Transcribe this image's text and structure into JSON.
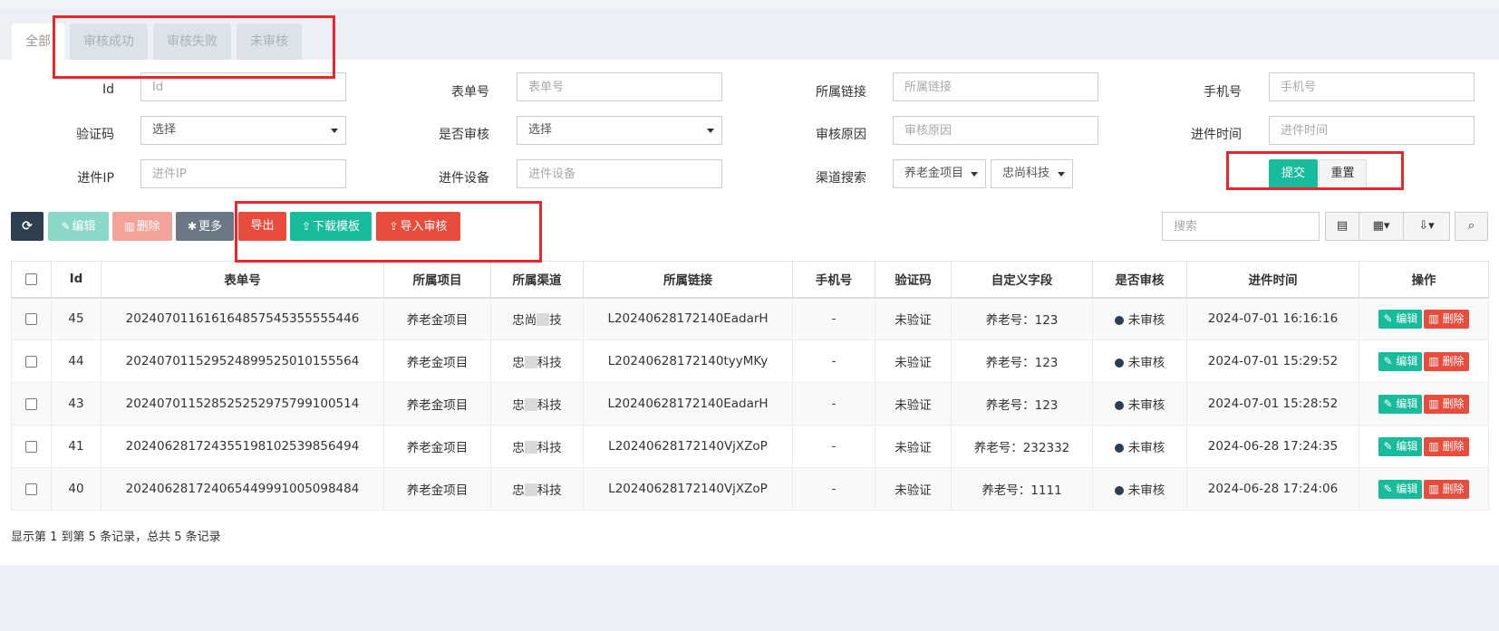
{
  "tabs": [
    "全部",
    "审核成功",
    "审核失败",
    "未审核"
  ],
  "filters": {
    "id_label": "Id",
    "id_placeholder": "Id",
    "form_no_label": "表单号",
    "form_no_placeholder": "表单号",
    "link_label": "所属链接",
    "link_placeholder": "所属链接",
    "phone_label": "手机号",
    "phone_placeholder": "手机号",
    "captcha_label": "验证码",
    "captcha_value": "选择",
    "audited_label": "是否审核",
    "audited_value": "选择",
    "reason_label": "审核原因",
    "reason_placeholder": "审核原因",
    "time_label": "进件时间",
    "time_placeholder": "进件时间",
    "ip_label": "进件IP",
    "ip_placeholder": "进件IP",
    "device_label": "进件设备",
    "device_placeholder": "进件设备",
    "channel_label": "渠道搜索",
    "channel_project": "养老金项目",
    "channel_company": "忠尚科技",
    "submit": "提交",
    "reset": "重置"
  },
  "toolbar": {
    "edit": "编辑",
    "delete": "删除",
    "more": "更多",
    "export": "导出",
    "download_template": "下载模板",
    "import_audit": "导入审核",
    "search_placeholder": "搜索"
  },
  "table": {
    "headers": [
      "Id",
      "表单号",
      "所属项目",
      "所属渠道",
      "所属链接",
      "手机号",
      "验证码",
      "自定义字段",
      "是否审核",
      "进件时间",
      "操作"
    ],
    "rows": [
      {
        "id": "45",
        "form_no": "202407011616164857545355555446",
        "project": "养老金项目",
        "channel_a": "忠尚",
        "channel_b": "技",
        "link": "L20240628172140EadarH",
        "phone": "-",
        "captcha": "未验证",
        "custom": "养老号：123",
        "audited": "未审核",
        "time": "2024-07-01 16:16:16"
      },
      {
        "id": "44",
        "form_no": "202407011529524899525010155564",
        "project": "养老金项目",
        "channel_a": "忠",
        "channel_b": "科技",
        "link": "L20240628172140tyyMKy",
        "phone": "-",
        "captcha": "未验证",
        "custom": "养老号：123",
        "audited": "未审核",
        "time": "2024-07-01 15:29:52"
      },
      {
        "id": "43",
        "form_no": "202407011528525252975799100514",
        "project": "养老金项目",
        "channel_a": "忠",
        "channel_b": "科技",
        "link": "L20240628172140EadarH",
        "phone": "-",
        "captcha": "未验证",
        "custom": "养老号：123",
        "audited": "未审核",
        "time": "2024-07-01 15:28:52"
      },
      {
        "id": "41",
        "form_no": "202406281724355198102539856494",
        "project": "养老金项目",
        "channel_a": "忠",
        "channel_b": "科技",
        "link": "L20240628172140VjXZoP",
        "phone": "-",
        "captcha": "未验证",
        "custom": "养老号：232332",
        "audited": "未审核",
        "time": "2024-06-28 17:24:35"
      },
      {
        "id": "40",
        "form_no": "202406281724065449991005098484",
        "project": "养老金项目",
        "channel_a": "忠",
        "channel_b": "科技",
        "link": "L20240628172140VjXZoP",
        "phone": "-",
        "captcha": "未验证",
        "custom": "养老号：1111",
        "audited": "未审核",
        "time": "2024-06-28 17:24:06"
      }
    ],
    "row_edit": "编辑",
    "row_delete": "删除"
  },
  "pagination": "显示第 1 到第 5 条记录，总共 5 条记录",
  "colors": {
    "green": "#18bc9c",
    "red": "#e74c3c",
    "navy": "#2c3e50",
    "highlight": "#e8262b"
  }
}
